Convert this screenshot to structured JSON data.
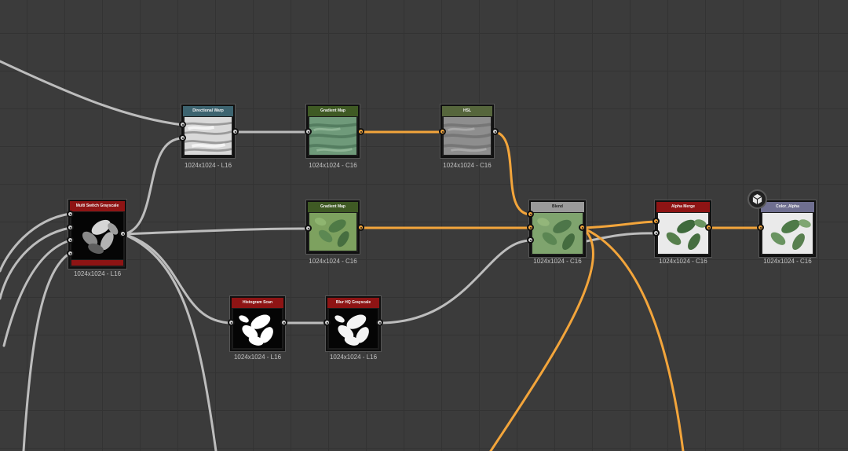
{
  "canvas": {
    "background": "#3b3b3b",
    "grid": "#333333"
  },
  "colors": {
    "wire_gray": "#bdbdbd",
    "wire_orange": "#f3a53b",
    "header_red": "#8e1414",
    "header_teal": "#3d6470",
    "header_green": "#3f5a24",
    "header_olive": "#56663c",
    "header_gray": "#9a9a9a",
    "header_violet": "#6f6f90"
  },
  "nodes": {
    "multi_switch": {
      "title": "Multi Switch Grayscale",
      "info": "1024x1024 - L16"
    },
    "directional_warp": {
      "title": "Directional Warp",
      "info": "1024x1024 - L16"
    },
    "gradient_map_1": {
      "title": "Gradient Map",
      "info": "1024x1024 - C16"
    },
    "hsl": {
      "title": "HSL",
      "info": "1024x1024 - C16"
    },
    "gradient_map_2": {
      "title": "Gradient Map",
      "info": "1024x1024 - C16"
    },
    "blend": {
      "title": "Blend",
      "info": "1024x1024 - C16"
    },
    "alpha_merge": {
      "title": "Alpha Merge",
      "info": "1024x1024 - C16"
    },
    "color_alpha": {
      "title": "Color_Alpha",
      "info": "1024x1024 - C16"
    },
    "histogram_scan": {
      "title": "Histogram Scan",
      "info": "1024x1024 - L16"
    },
    "blur_hq": {
      "title": "Blur HQ Grayscale",
      "info": "1024x1024 - L16"
    }
  },
  "icons": {
    "output_frame": "cube-icon"
  }
}
